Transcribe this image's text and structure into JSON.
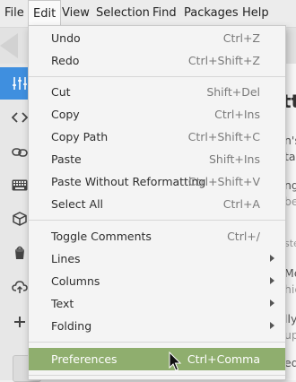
{
  "menubar": {
    "items": [
      "File",
      "Edit",
      "View",
      "Selection",
      "Find",
      "Packages",
      "Help"
    ]
  },
  "background": {
    "sidebar_icons": [
      "sliders-icon",
      "code-icon",
      "link-icon",
      "keyboard-icon",
      "package-icon",
      "paint-bucket-icon",
      "cloud-upload-icon",
      "plus-icon"
    ],
    "content_fragments": [
      "tt",
      "n's",
      "ta",
      "ng",
      "be",
      "ste",
      "Mer",
      "hic",
      "lly",
      "up",
      "ed"
    ]
  },
  "edit_menu": {
    "groups": [
      [
        {
          "label": "Undo",
          "shortcut": "Ctrl+Z"
        },
        {
          "label": "Redo",
          "shortcut": "Ctrl+Shift+Z"
        }
      ],
      [
        {
          "label": "Cut",
          "shortcut": "Shift+Del"
        },
        {
          "label": "Copy",
          "shortcut": "Ctrl+Ins"
        },
        {
          "label": "Copy Path",
          "shortcut": "Ctrl+Shift+C"
        },
        {
          "label": "Paste",
          "shortcut": "Shift+Ins"
        },
        {
          "label": "Paste Without Reformatting",
          "shortcut": "Ctrl+Shift+V"
        },
        {
          "label": "Select All",
          "shortcut": "Ctrl+A"
        }
      ],
      [
        {
          "label": "Toggle Comments",
          "shortcut": "Ctrl+/"
        },
        {
          "label": "Lines",
          "submenu": true
        },
        {
          "label": "Columns",
          "submenu": true
        },
        {
          "label": "Text",
          "submenu": true
        },
        {
          "label": "Folding",
          "submenu": true
        }
      ],
      [
        {
          "label": "Preferences",
          "shortcut": "Ctrl+Comma",
          "highlighted": true
        }
      ]
    ]
  },
  "colors": {
    "highlight": "#8fae6e",
    "sidebar_selected": "#3f8fdf"
  }
}
